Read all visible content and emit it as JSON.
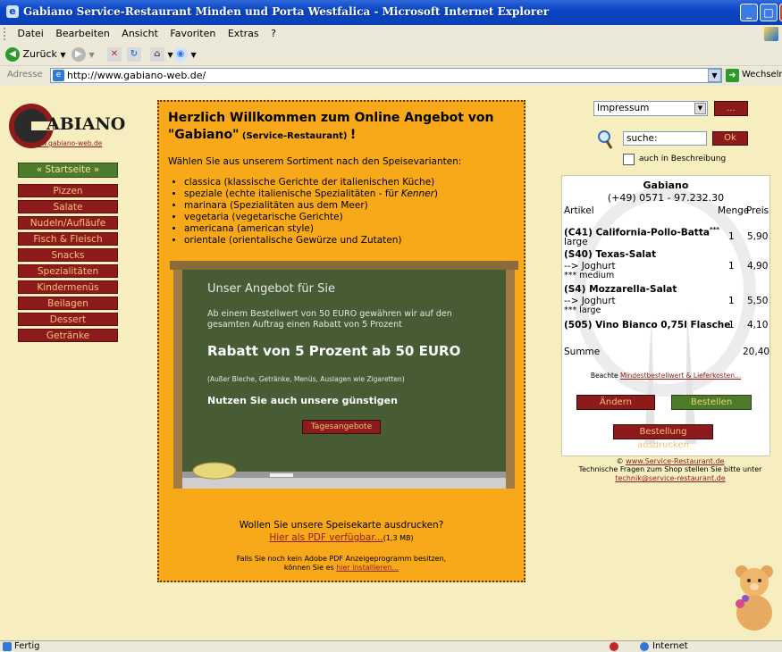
{
  "window": {
    "title": "Gabiano Service-Restaurant Minden und Porta Westfalica - Microsoft Internet Explorer",
    "minimize": "_",
    "maximize": "□",
    "close": "X"
  },
  "menu": [
    "Datei",
    "Bearbeiten",
    "Ansicht",
    "Favoriten",
    "Extras",
    "?"
  ],
  "toolbar": {
    "back_label": "Zurück"
  },
  "address": {
    "label": "Adresse",
    "url": "http://www.gabiano-web.de/",
    "go_label": "Wechseln zu"
  },
  "status": {
    "left": "Fertig",
    "zone": "Internet"
  },
  "logo": {
    "letter": "G",
    "name": "ABIANO",
    "url": "www.gabiano-web.de"
  },
  "nav": {
    "home": "« Startseite »",
    "items": [
      "Pizzen",
      "Salate",
      "Nudeln/Aufläufe",
      "Fisch & Fleisch",
      "Snacks",
      "Spezialitäten",
      "Kindermenüs",
      "Beilagen",
      "Dessert",
      "Getränke"
    ]
  },
  "main": {
    "heading1": "Herzlich Willkommen zum Online Angebot von",
    "heading2_name": "\"Gabiano\"",
    "heading2_sub": "(Service-Restaurant)",
    "heading2_end": "!",
    "intro": "Wählen Sie aus unserem Sortiment nach den Speisevarianten:",
    "variants": [
      {
        "text": "classica (klassische Gerichte der italienischen Küche)"
      },
      {
        "text": "speziale (echte italienische Spezialitäten - für ",
        "italic": "Kenner",
        "after": ")"
      },
      {
        "text": "marinara (Spezialitäten aus dem Meer)"
      },
      {
        "text": "vegetaria (vegetarische Gerichte)"
      },
      {
        "text": "americana (american style)"
      },
      {
        "text": "orientale (orientalische Gewürze und Zutaten)"
      }
    ],
    "board": {
      "title": "Unser Angebot für Sie",
      "text": "Ab einem Bestellwert von 50 EURO gewähren wir auf den gesamten Auftrag einen Rabatt von 5 Prozent",
      "rabatt": "Rabatt von 5 Prozent ab 50 EURO",
      "exclusions": "(Außer Bleche, Getränke, Menüs, Auslagen wie Zigaretten)",
      "nutzen": "Nutzen Sie auch unsere günstigen",
      "button": "Tagesangebote"
    },
    "print_question": "Wollen Sie unsere Speisekarte ausdrucken?",
    "pdf_link": "Hier als PDF verfügbar...",
    "pdf_size": "(1,3 MB)",
    "adobe_line1": "Falls Sie noch kein Adobe PDF Anzeigeprogramm besitzen,",
    "adobe_line2_pre": "können Sie es ",
    "adobe_link": "hier installieren..."
  },
  "right": {
    "select_value": "Impressum",
    "select_btn": "...",
    "search_value": "suche:",
    "ok_btn": "Ok",
    "checkbox_label": "auch in Beschreibung"
  },
  "basket": {
    "name": "Gabiano",
    "phone": "(+49) 0571 - 97.232.30",
    "col_article": "Artikel",
    "col_qty": "Menge",
    "col_price": "Preis",
    "items": [
      {
        "title": "(C41) California-Pollo-Batta",
        "stars": "***",
        "lines": [
          "large"
        ],
        "qty": "1",
        "price": "5,90"
      },
      {
        "title": "(S40) Texas-Salat",
        "stars": "",
        "lines": [
          "--> Joghurt",
          "*** medium"
        ],
        "qty": "1",
        "price": "4,90"
      },
      {
        "title": "(S4) Mozzarella-Salat",
        "stars": "",
        "lines": [
          "--> Joghurt",
          "*** large"
        ],
        "qty": "1",
        "price": "5,50"
      },
      {
        "title": "(505) Vino Bianco 0,75l Flasche",
        "stars": "",
        "lines": [],
        "qty": "1",
        "price": "4,10"
      }
    ],
    "sum_label": "Summe",
    "sum_value": "20,40",
    "note_pre": "Beachte ",
    "note_link": "Mindestbestellwert & Lieferkosten...",
    "btn_change": "Ändern",
    "btn_order": "Bestellen",
    "btn_print": "Bestellung ausdrucken"
  },
  "footer": {
    "copy_pre": "© ",
    "copy_link": "www.Service-Restaurant.de",
    "tech": "Technische Fragen zum Shop stellen Sie bitte unter",
    "email": "technik@service-restaurant.de"
  }
}
